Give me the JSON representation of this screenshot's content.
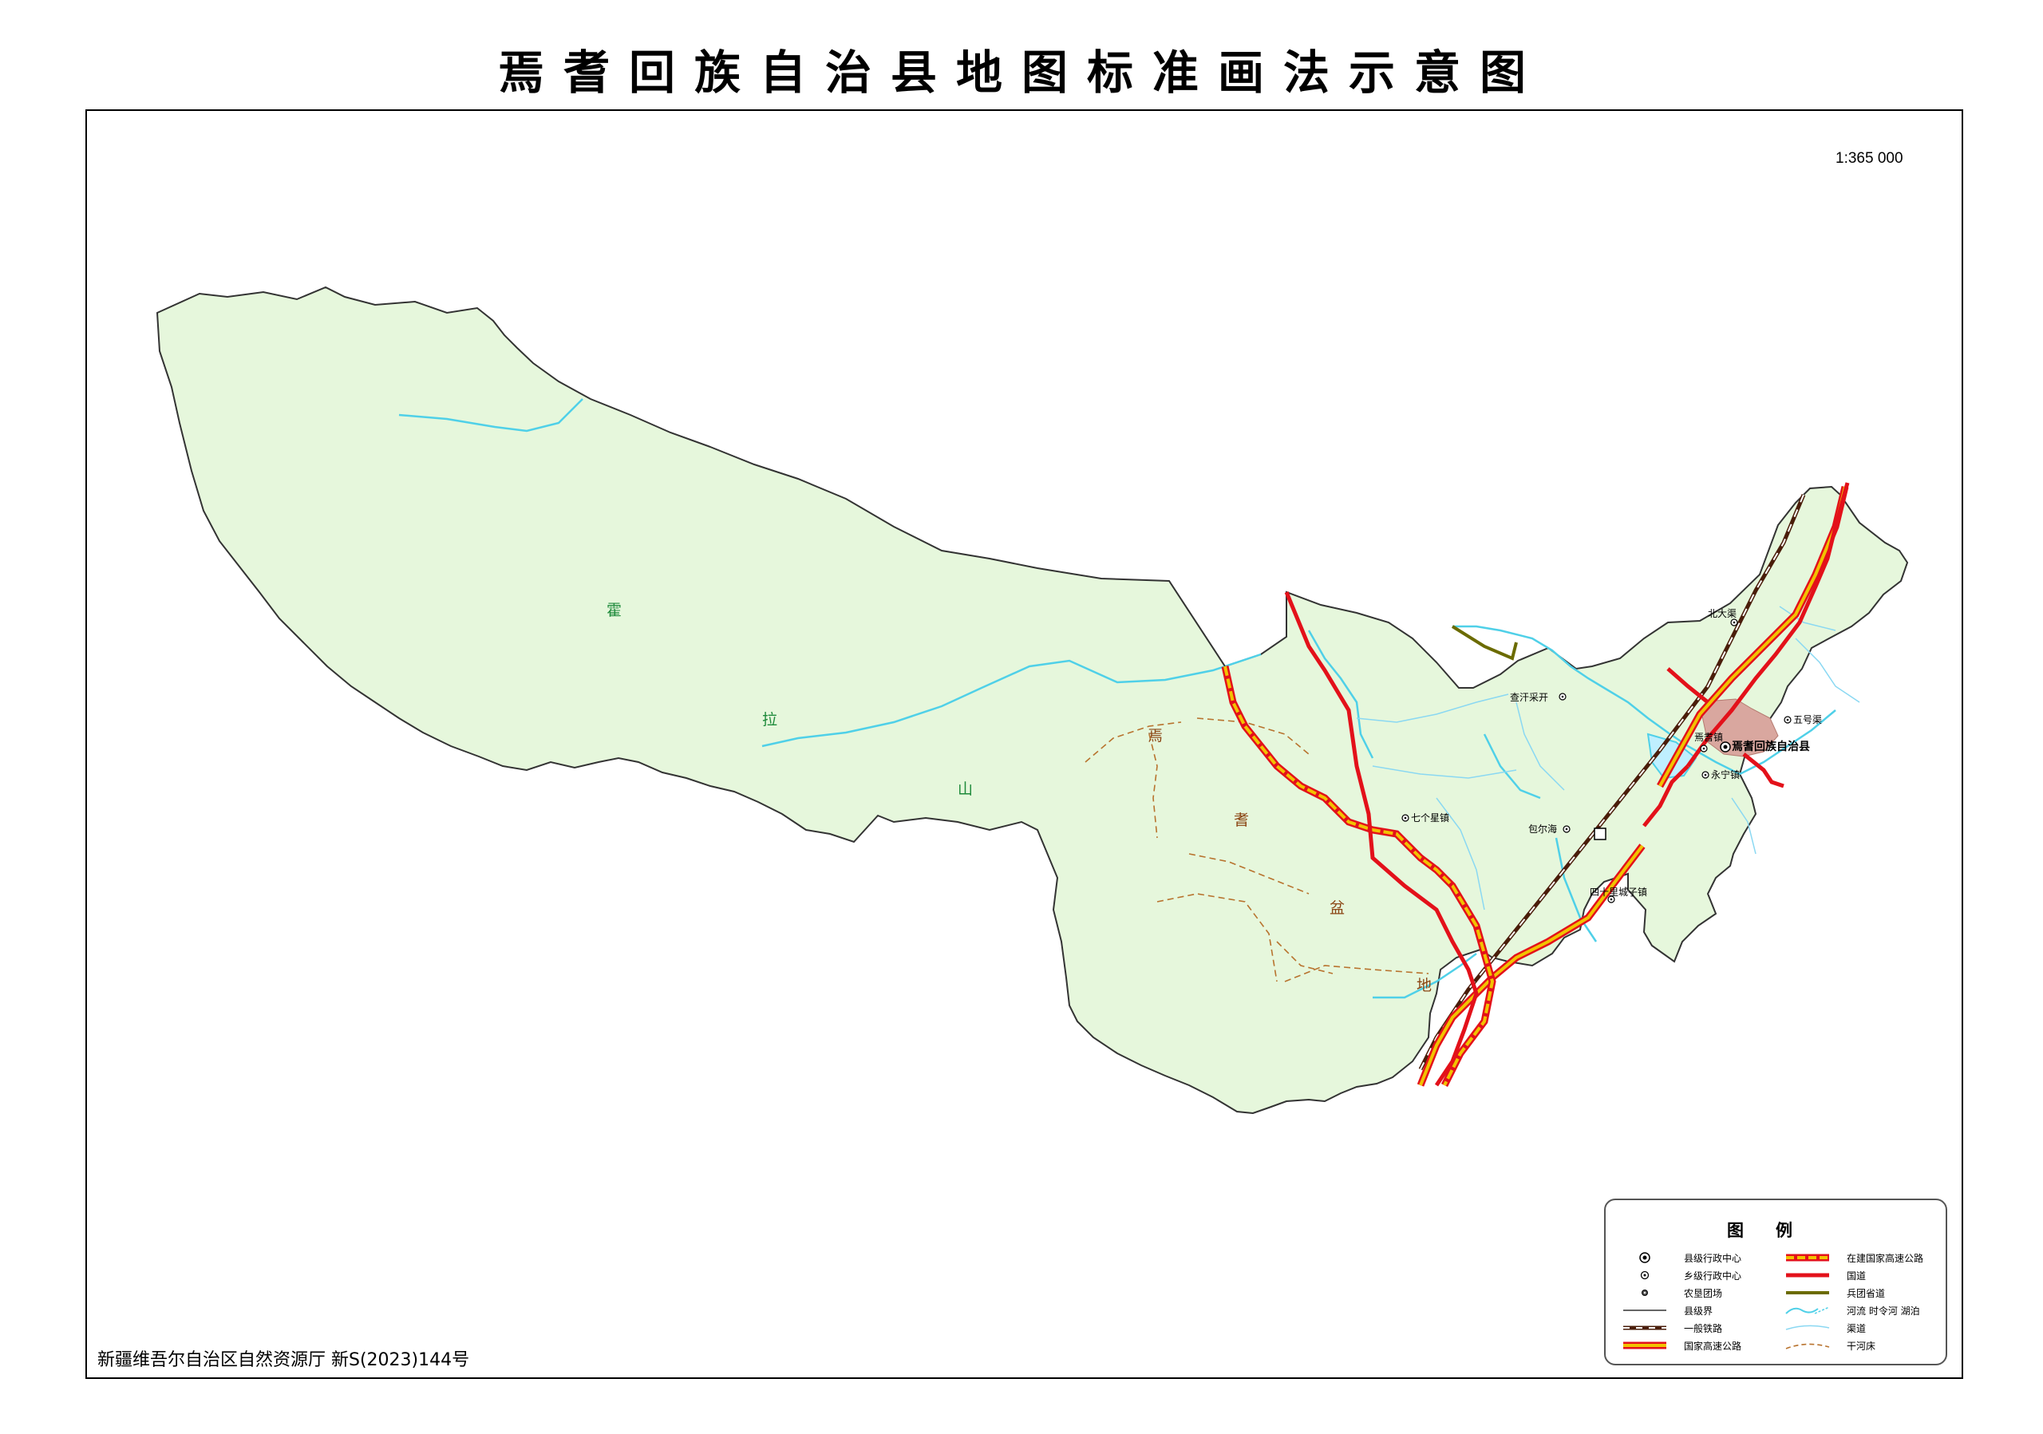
{
  "title": "焉耆回族自治县地图标准画法示意图",
  "scale": "1:365 000",
  "approval_note": "新疆维吾尔自治区自然资源厅 新S(2023)144号",
  "terrain_labels": [
    {
      "text": "霍",
      "color": "green"
    },
    {
      "text": "拉",
      "color": "green"
    },
    {
      "text": "山",
      "color": "green"
    },
    {
      "text": "焉",
      "color": "brown"
    },
    {
      "text": "耆",
      "color": "brown"
    },
    {
      "text": "盆",
      "color": "brown"
    },
    {
      "text": "地",
      "color": "brown"
    }
  ],
  "places": [
    {
      "name": "北大渠",
      "type": "township"
    },
    {
      "name": "查汗采开",
      "type": "township"
    },
    {
      "name": "五号渠",
      "type": "township"
    },
    {
      "name": "焉耆镇",
      "type": "township"
    },
    {
      "name": "焉耆回族自治县",
      "type": "county"
    },
    {
      "name": "永宁镇",
      "type": "township"
    },
    {
      "name": "七个星镇",
      "type": "township"
    },
    {
      "name": "包尔海",
      "type": "township"
    },
    {
      "name": "四十里城子镇",
      "type": "township"
    }
  ],
  "legend": {
    "title": "图例",
    "items": [
      {
        "label": "县级行政中心",
        "symbol": "county-center-icon"
      },
      {
        "label": "乡级行政中心",
        "symbol": "township-center-icon"
      },
      {
        "label": "农垦团场",
        "symbol": "farm-regiment-icon"
      },
      {
        "label": "县级界",
        "symbol": "county-boundary-line"
      },
      {
        "label": "一般铁路",
        "symbol": "railway-line"
      },
      {
        "label": "国家高速公路",
        "symbol": "expressway-line"
      },
      {
        "label": "在建国家高速公路",
        "symbol": "expressway-construction-line"
      },
      {
        "label": "国道",
        "symbol": "national-road-line"
      },
      {
        "label": "兵团省道",
        "symbol": "corps-provincial-road-line"
      },
      {
        "label": "河流  时令河  湖泊",
        "symbol": "river-lake-icon"
      },
      {
        "label": "渠道",
        "symbol": "canal-line"
      },
      {
        "label": "干河床",
        "symbol": "dry-riverbed-line"
      }
    ]
  },
  "colors": {
    "land": "#e6f7dc",
    "boundary": "#333333",
    "river": "#4fd0e8",
    "national_road": "#e3111a",
    "expressway_fill": "#f2c200",
    "corps_road": "#6b6b00",
    "railway": "#4a1d0a",
    "dry_river": "#b8732e",
    "urban": "#d9a79f"
  }
}
